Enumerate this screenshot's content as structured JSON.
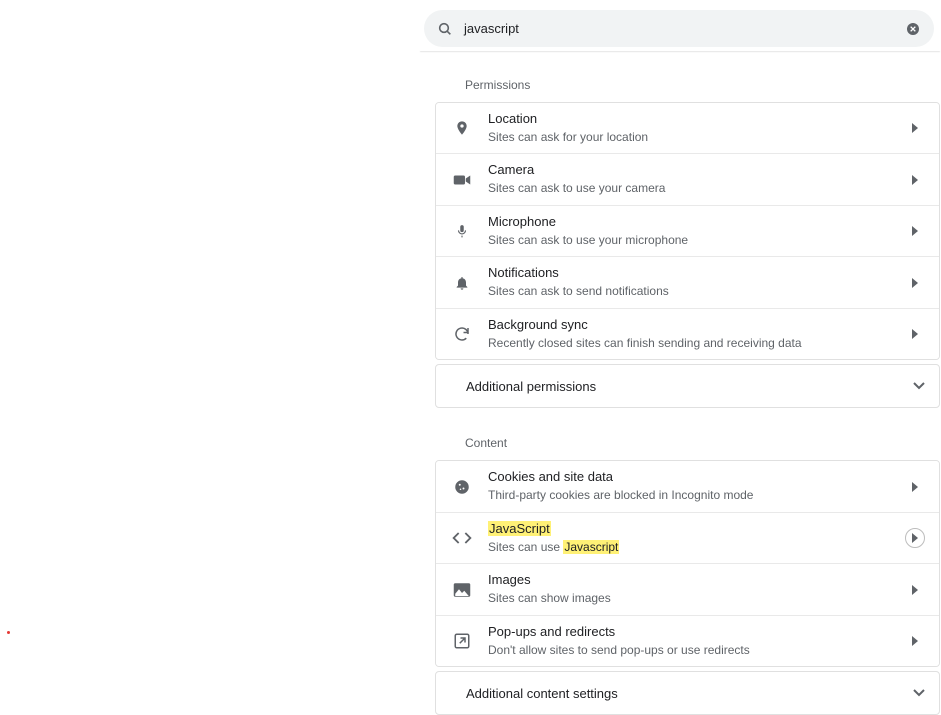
{
  "search": {
    "query": "javascript"
  },
  "sections": {
    "permissions_title": "Permissions",
    "content_title": "Content"
  },
  "permissions": [
    {
      "title": "Location",
      "subtitle": "Sites can ask for your location"
    },
    {
      "title": "Camera",
      "subtitle": "Sites can ask to use your camera"
    },
    {
      "title": "Microphone",
      "subtitle": "Sites can ask to use your microphone"
    },
    {
      "title": "Notifications",
      "subtitle": "Sites can ask to send notifications"
    },
    {
      "title": "Background sync",
      "subtitle": "Recently closed sites can finish sending and receiving data"
    }
  ],
  "additional_permissions_label": "Additional permissions",
  "content": [
    {
      "title": "Cookies and site data",
      "subtitle": "Third-party cookies are blocked in Incognito mode"
    },
    {
      "title": "JavaScript",
      "subtitle_pre": "Sites can use ",
      "subtitle_hl": "Javascript"
    },
    {
      "title": "Images",
      "subtitle": "Sites can show images"
    },
    {
      "title": "Pop-ups and redirects",
      "subtitle": "Don't allow sites to send pop-ups or use redirects"
    }
  ],
  "additional_content_label": "Additional content settings"
}
